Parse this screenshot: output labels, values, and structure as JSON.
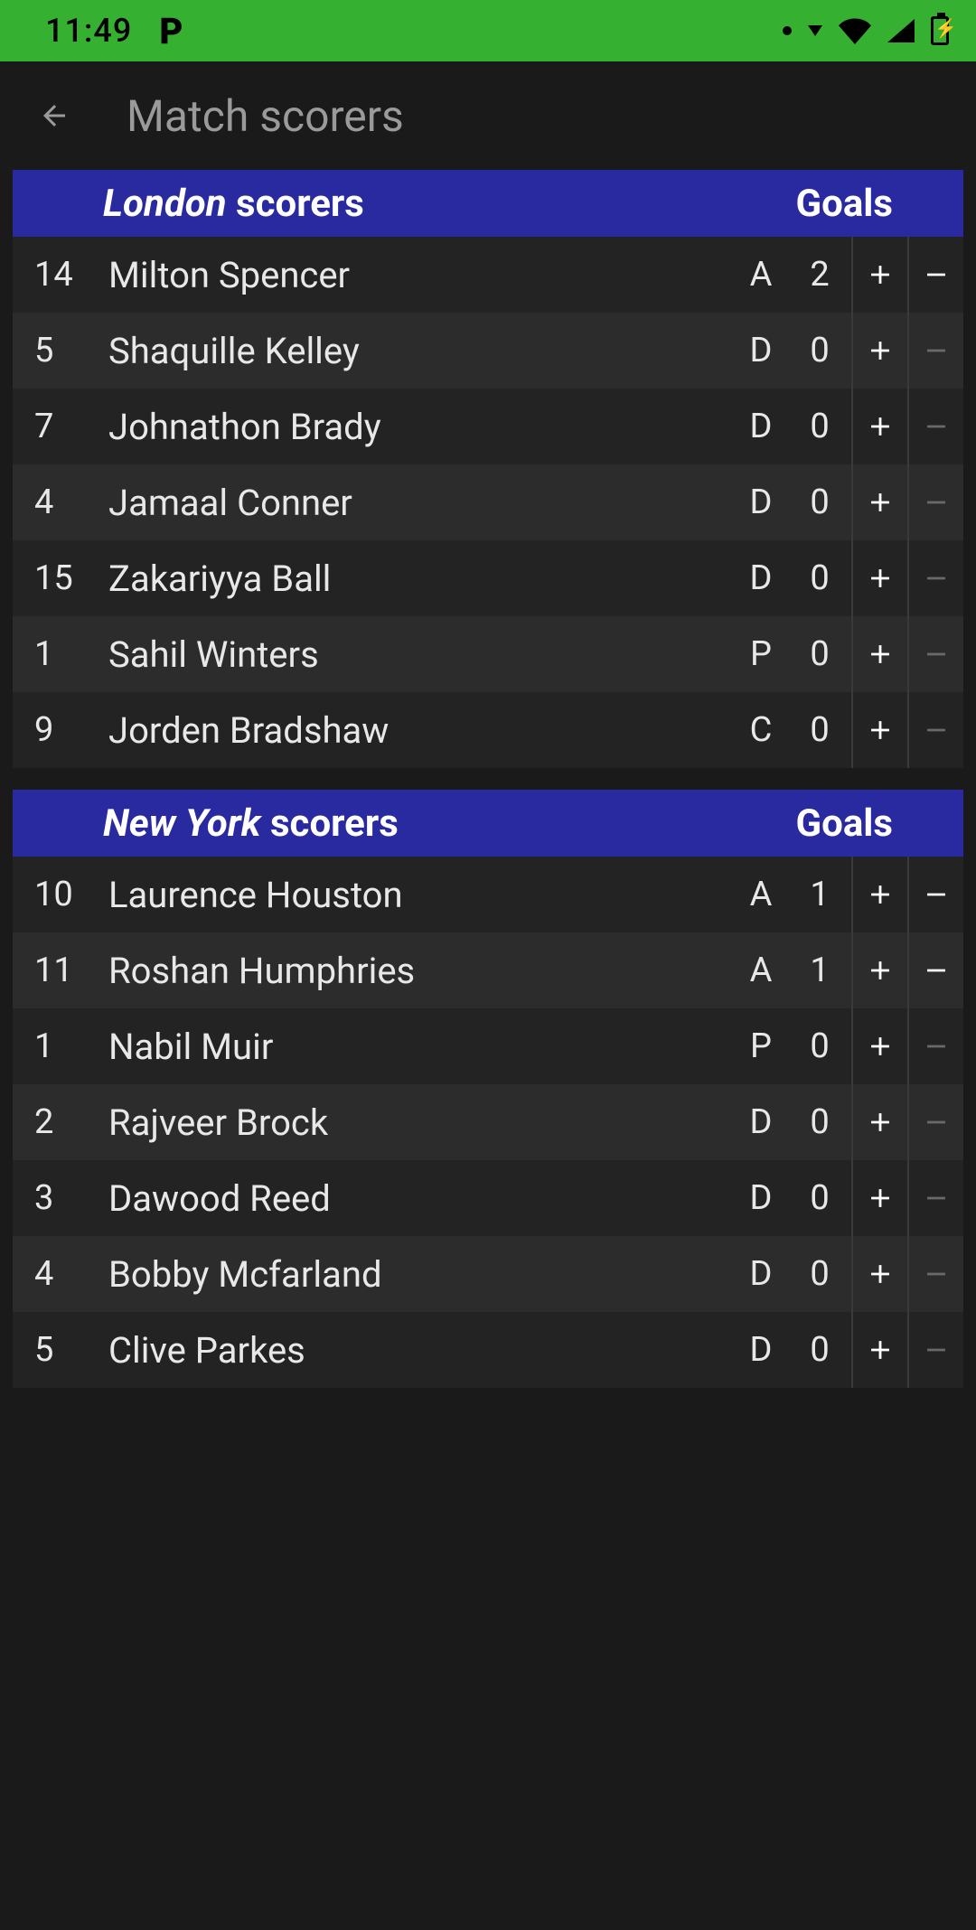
{
  "status": {
    "time": "11:49"
  },
  "header": {
    "title": "Match scorers"
  },
  "sections": [
    {
      "team": "London",
      "title_suffix": "scorers",
      "goals_label": "Goals",
      "players": [
        {
          "num": "14",
          "name": "Milton Spencer",
          "pos": "A",
          "goals": "2",
          "minus_enabled": true
        },
        {
          "num": "5",
          "name": "Shaquille Kelley",
          "pos": "D",
          "goals": "0",
          "minus_enabled": false
        },
        {
          "num": "7",
          "name": "Johnathon Brady",
          "pos": "D",
          "goals": "0",
          "minus_enabled": false
        },
        {
          "num": "4",
          "name": "Jamaal Conner",
          "pos": "D",
          "goals": "0",
          "minus_enabled": false
        },
        {
          "num": "15",
          "name": "Zakariyya Ball",
          "pos": "D",
          "goals": "0",
          "minus_enabled": false
        },
        {
          "num": "1",
          "name": "Sahil Winters",
          "pos": "P",
          "goals": "0",
          "minus_enabled": false
        },
        {
          "num": "9",
          "name": "Jorden Bradshaw",
          "pos": "C",
          "goals": "0",
          "minus_enabled": false
        }
      ]
    },
    {
      "team": "New York",
      "title_suffix": "scorers",
      "goals_label": "Goals",
      "players": [
        {
          "num": "10",
          "name": "Laurence Houston",
          "pos": "A",
          "goals": "1",
          "minus_enabled": true
        },
        {
          "num": "11",
          "name": "Roshan Humphries",
          "pos": "A",
          "goals": "1",
          "minus_enabled": true
        },
        {
          "num": "1",
          "name": "Nabil Muir",
          "pos": "P",
          "goals": "0",
          "minus_enabled": false
        },
        {
          "num": "2",
          "name": "Rajveer Brock",
          "pos": "D",
          "goals": "0",
          "minus_enabled": false
        },
        {
          "num": "3",
          "name": "Dawood Reed",
          "pos": "D",
          "goals": "0",
          "minus_enabled": false
        },
        {
          "num": "4",
          "name": "Bobby Mcfarland",
          "pos": "D",
          "goals": "0",
          "minus_enabled": false
        },
        {
          "num": "5",
          "name": "Clive Parkes",
          "pos": "D",
          "goals": "0",
          "minus_enabled": false
        }
      ]
    }
  ]
}
